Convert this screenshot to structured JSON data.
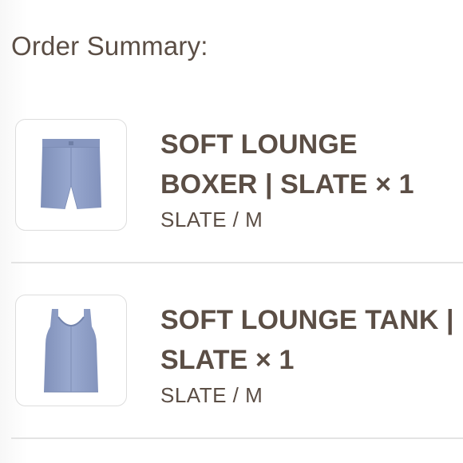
{
  "summary": {
    "title": "Order Summary:"
  },
  "items": [
    {
      "name": "SOFT LOUNGE BOXER | SLATE × 1",
      "variant": "SLATE / M",
      "image_icon": "boxer-shorts-image",
      "color": "#8e9ec6"
    },
    {
      "name": "SOFT LOUNGE TANK | SLATE × 1",
      "variant": "SLATE / M",
      "image_icon": "tank-top-image",
      "color": "#8e9ec6"
    }
  ],
  "colors": {
    "text": "#5b4e45",
    "divider": "#e3e3e3",
    "thumb_border": "#dddddd"
  }
}
